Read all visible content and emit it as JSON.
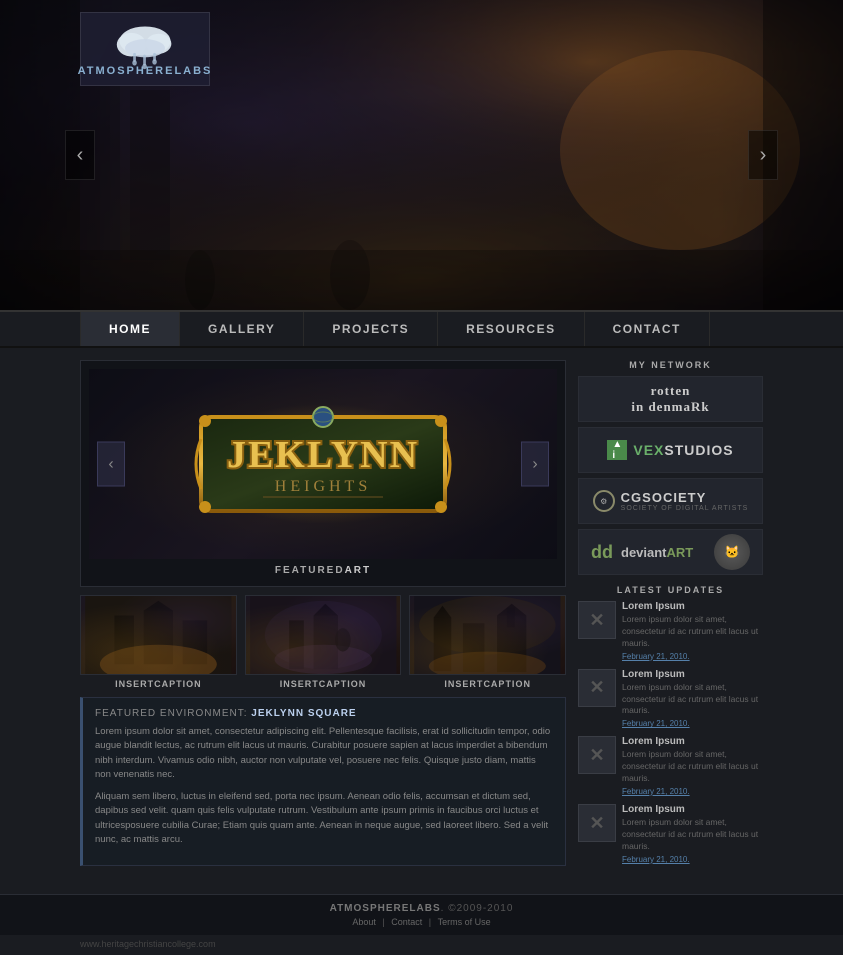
{
  "site": {
    "brand": "ATMOSPHERELABS",
    "brand_part1": "ATMOSPHERE",
    "brand_part2": "LABS",
    "copyright": "ATMOSPHERELABS. ©2009-2010"
  },
  "nav": {
    "items": [
      {
        "label": "HOME",
        "active": true
      },
      {
        "label": "GALLERY",
        "active": false
      },
      {
        "label": "PROJECTS",
        "active": false
      },
      {
        "label": "RESOURCES",
        "active": false
      },
      {
        "label": "CONTACT",
        "active": false
      }
    ]
  },
  "hero": {
    "prev_label": "‹",
    "next_label": "›"
  },
  "carousel": {
    "prev_label": "‹",
    "next_label": "›",
    "logo_text": "JEKLYNN",
    "logo_sub": "HEIGHTS",
    "featured_label": "FEATURED",
    "featured_label2": "ART"
  },
  "thumbnails": [
    {
      "caption1": "INSERT",
      "caption2": "CAPTION"
    },
    {
      "caption1": "INSERT",
      "caption2": "CAPTION"
    },
    {
      "caption1": "INSERT",
      "caption2": "CAPTION"
    }
  ],
  "description": {
    "prefix": "FEATURED ENVIRONMENT:",
    "title": " JEKLYNN SQUARE",
    "para1": "Lorem ipsum dolor sit amet, consectetur adipiscing elit. Pellentesque facilisis, erat id sollicitudin tempor, odio augue blandit lectus, ac rutrum elit lacus ut mauris. Curabitur posuere sapien at lacus imperdiet a bibendum nibh interdum. Vivamus odio nibh, auctor non vulputate vel, posuere nec felis. Quisque justo diam, mattis non venenatis nec.",
    "para2": "Aliquam sem libero, luctus in eleifend sed, porta nec ipsum. Aenean odio felis, accumsan et dictum sed, dapibus sed velit. quam quis felis vulputate rutrum. Vestibulum ante ipsum primis in faucibus orci luctus et ultricesposuere cubilia Curae; Etiam quis quam ante. Aenean in neque augue, sed laoreet libero. Sed a velit nunc, ac mattis arcu."
  },
  "sidebar": {
    "network_title1": "MY",
    "network_title2": "NETWORK",
    "networks": [
      {
        "name": "rotten-in-denmark",
        "display": "rotten\nin denmaRk",
        "type": "rotten"
      },
      {
        "name": "vex-studios",
        "display": "VEX STUDIOS",
        "type": "vex"
      },
      {
        "name": "cg-society",
        "display": "CGSOCIETY",
        "type": "cg"
      },
      {
        "name": "deviantart",
        "display": "deviantART",
        "type": "da"
      }
    ],
    "updates_title1": "LATEST",
    "updates_title2": "UPDATES",
    "updates": [
      {
        "title": "Lorem Ipsum",
        "body": "Lorem ipsum dolor sit amet, consectetur id ac rutrum elit lacus ut mauris.",
        "date": "February 21, 2010."
      },
      {
        "title": "Lorem Ipsum",
        "body": "Lorem ipsum dolor sit amet, consectetur id ac rutrum elit lacus ut mauris.",
        "date": "February 21, 2010."
      },
      {
        "title": "Lorem Ipsum",
        "body": "Lorem ipsum dolor sit amet, consectetur id ac rutrum elit lacus ut mauris.",
        "date": "February 21, 2010."
      },
      {
        "title": "Lorem Ipsum",
        "body": "Lorem ipsum dolor sit amet, consectetur id ac rutrum elit lacus ut mauris.",
        "date": "February 21, 2010."
      }
    ]
  },
  "footer": {
    "copyright": "ATMOSPHERELABS. ©2009-2010",
    "brand_main": "ATMOSPHERE",
    "brand_sub": "LABS",
    "links": [
      "About",
      "Contact",
      "Terms of Use"
    ]
  },
  "bottom_url": "www.heritagechristiancollege.com"
}
